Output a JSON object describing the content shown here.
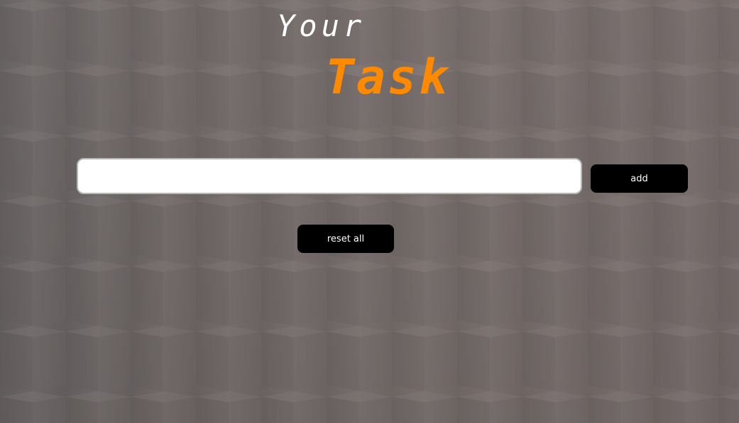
{
  "header": {
    "title_line1": "Your",
    "title_line2": "Task",
    "accent_color": "#ff8a00"
  },
  "form": {
    "task_input_value": "",
    "add_label": "add"
  },
  "controls": {
    "reset_label": "reset all"
  }
}
